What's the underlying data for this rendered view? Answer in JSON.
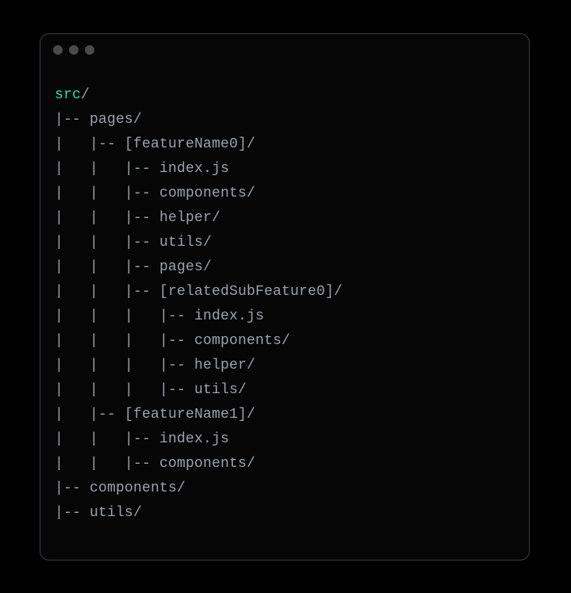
{
  "tree": {
    "root": "src",
    "lines": [
      {
        "prefix": "|-- ",
        "text": "pages/"
      },
      {
        "prefix": "|   |-- ",
        "text": "[featureName0]/"
      },
      {
        "prefix": "|   |   |-- ",
        "text": "index.js"
      },
      {
        "prefix": "|   |   |-- ",
        "text": "components/"
      },
      {
        "prefix": "|   |   |-- ",
        "text": "helper/"
      },
      {
        "prefix": "|   |   |-- ",
        "text": "utils/"
      },
      {
        "prefix": "|   |   |-- ",
        "text": "pages/"
      },
      {
        "prefix": "|   |   |-- ",
        "text": "[relatedSubFeature0]/"
      },
      {
        "prefix": "|   |   |   |-- ",
        "text": "index.js"
      },
      {
        "prefix": "|   |   |   |-- ",
        "text": "components/"
      },
      {
        "prefix": "|   |   |   |-- ",
        "text": "helper/"
      },
      {
        "prefix": "|   |   |   |-- ",
        "text": "utils/"
      },
      {
        "prefix": "|   |-- ",
        "text": "[featureName1]/"
      },
      {
        "prefix": "|   |   |-- ",
        "text": "index.js"
      },
      {
        "prefix": "|   |   |-- ",
        "text": "components/"
      },
      {
        "prefix": "|-- ",
        "text": "components/"
      },
      {
        "prefix": "|-- ",
        "text": "utils/"
      }
    ]
  }
}
